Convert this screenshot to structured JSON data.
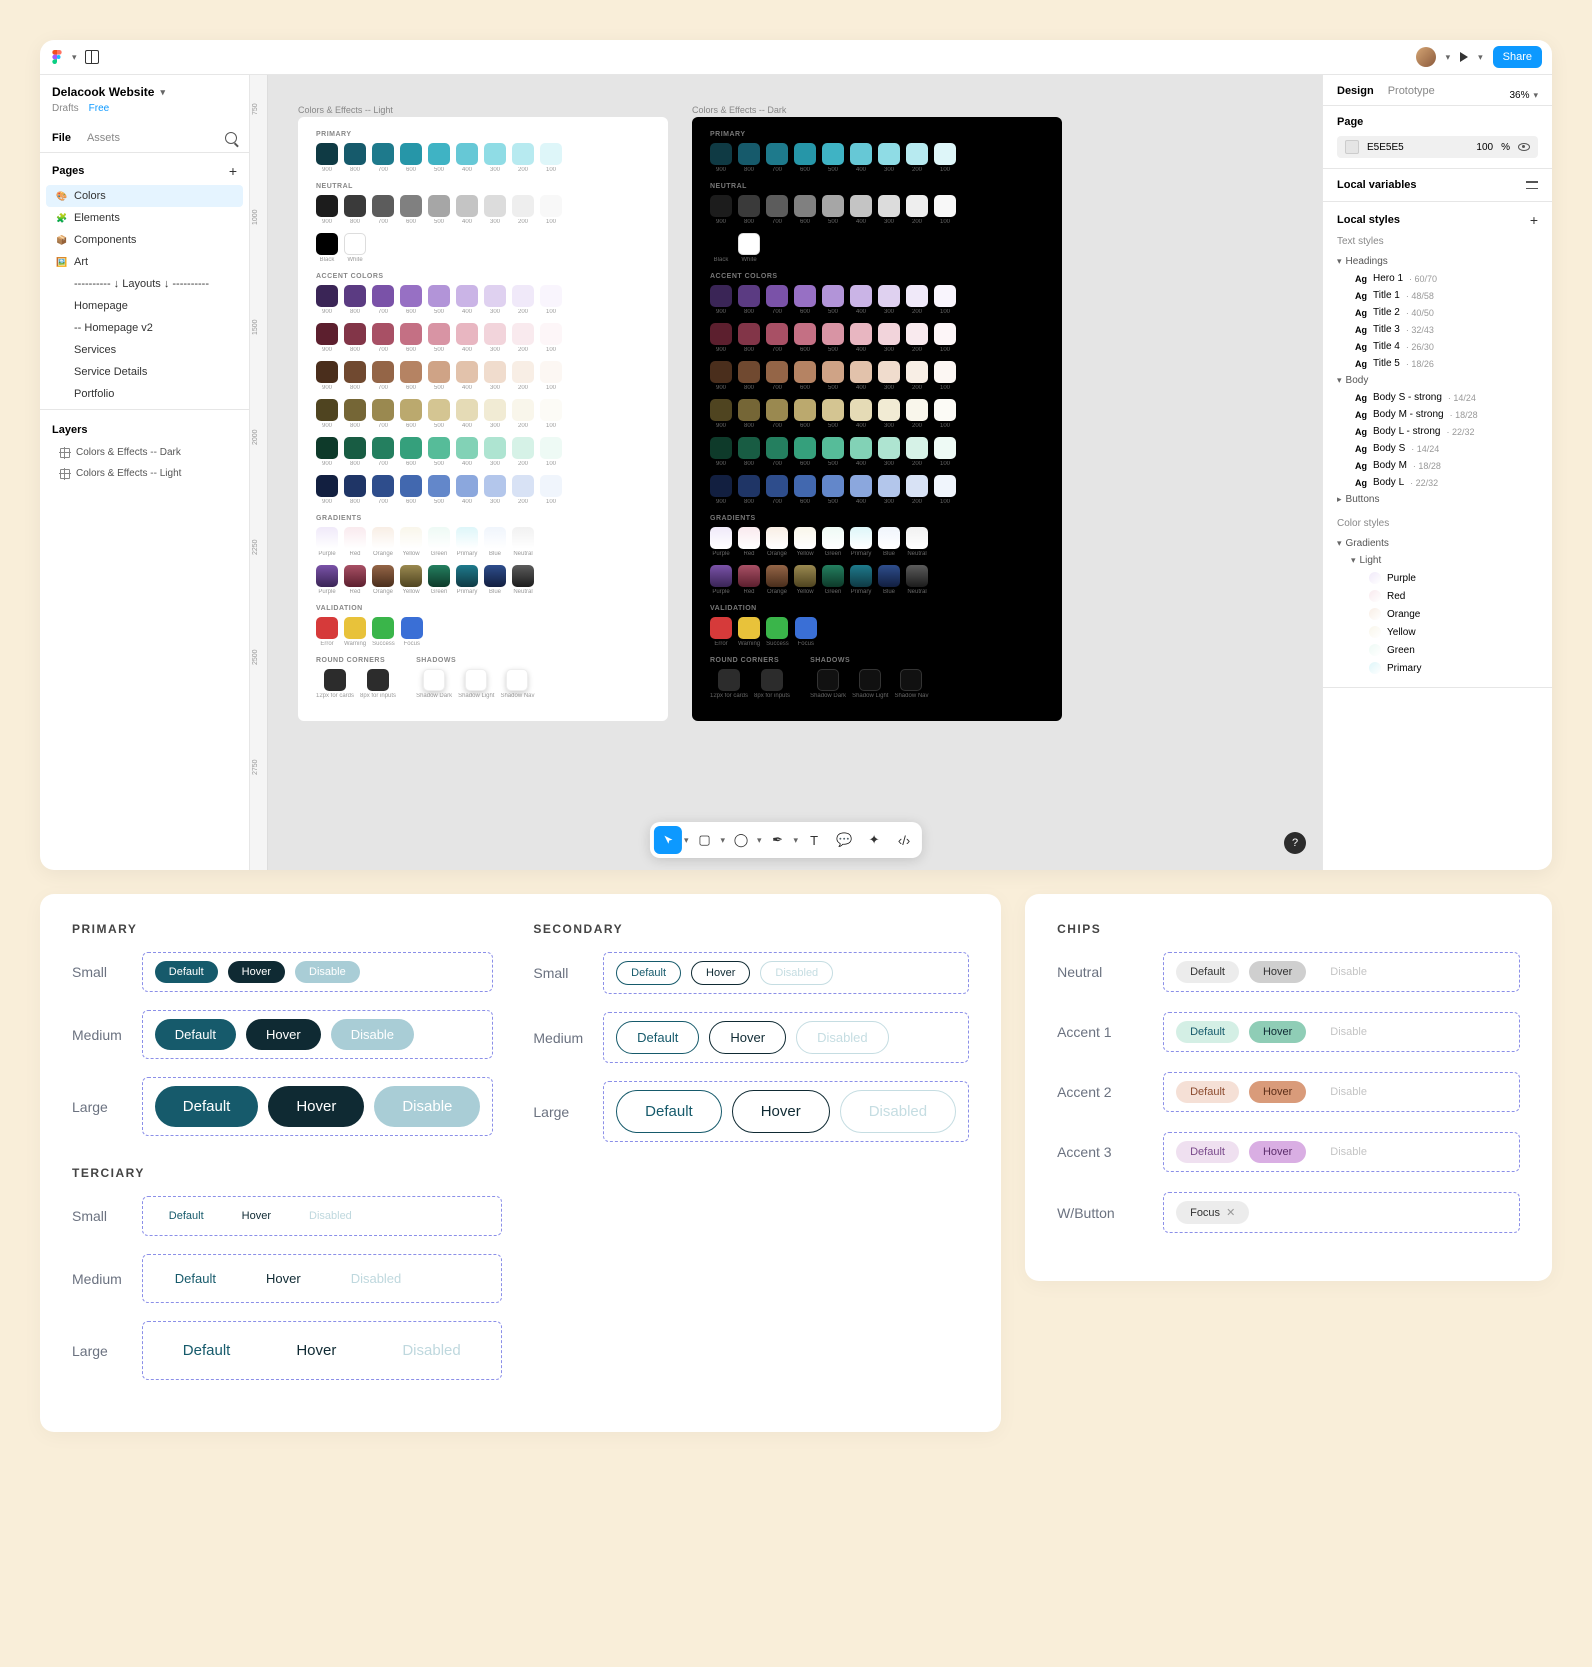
{
  "project": {
    "title": "Delacook Website",
    "drafts": "Drafts",
    "plan": "Free",
    "file_tab": "File",
    "assets_tab": "Assets"
  },
  "share": "Share",
  "pages": {
    "header": "Pages",
    "items": [
      {
        "icon": "🎨",
        "label": "Colors",
        "sel": true
      },
      {
        "icon": "🧩",
        "label": "Elements"
      },
      {
        "icon": "📦",
        "label": "Components"
      },
      {
        "icon": "🖼️",
        "label": "Art"
      },
      {
        "icon": "",
        "label": "---------- ↓ Layouts ↓ ----------"
      },
      {
        "icon": "",
        "label": "Homepage"
      },
      {
        "icon": "",
        "label": "-- Homepage v2"
      },
      {
        "icon": "",
        "label": "Services"
      },
      {
        "icon": "",
        "label": "Service Details"
      },
      {
        "icon": "",
        "label": "Portfolio"
      }
    ]
  },
  "layers": {
    "header": "Layers",
    "items": [
      "Colors & Effects -- Dark",
      "Colors & Effects -- Light"
    ]
  },
  "canvas_labels": {
    "light": "Colors & Effects -- Light",
    "dark": "Colors & Effects -- Dark"
  },
  "ruler": [
    "750",
    "1000",
    "1500",
    "2000",
    "2250",
    "2500",
    "2750"
  ],
  "palette": {
    "primary_title": "PRIMARY",
    "primary": [
      {
        "c": "#0F3A44",
        "l": "900"
      },
      {
        "c": "#165A6B",
        "l": "800"
      },
      {
        "c": "#1E7A8C",
        "l": "700"
      },
      {
        "c": "#2696A8",
        "l": "600"
      },
      {
        "c": "#3FB3C4",
        "l": "500"
      },
      {
        "c": "#66C8D6",
        "l": "400"
      },
      {
        "c": "#8FDCE5",
        "l": "300"
      },
      {
        "c": "#B7EAF0",
        "l": "200"
      },
      {
        "c": "#DEF6F9",
        "l": "100"
      }
    ],
    "neutral_title": "NEUTRAL",
    "neutral": [
      {
        "c": "#1C1C1C",
        "l": "900"
      },
      {
        "c": "#3A3A3A",
        "l": "800"
      },
      {
        "c": "#5C5C5C",
        "l": "700"
      },
      {
        "c": "#808080",
        "l": "600"
      },
      {
        "c": "#A6A6A6",
        "l": "500"
      },
      {
        "c": "#C4C4C4",
        "l": "400"
      },
      {
        "c": "#DCDCDC",
        "l": "300"
      },
      {
        "c": "#EEEEEE",
        "l": "200"
      },
      {
        "c": "#F8F8F8",
        "l": "100"
      }
    ],
    "bw": [
      {
        "c": "#000000",
        "l": "Black"
      },
      {
        "c": "#FFFFFF",
        "l": "White"
      }
    ],
    "accent_title": "ACCENT COLORS",
    "accent_rows": [
      [
        {
          "c": "#3A2556"
        },
        {
          "c": "#5B3B82"
        },
        {
          "c": "#7A52A8"
        },
        {
          "c": "#9770C4"
        },
        {
          "c": "#B294D8"
        },
        {
          "c": "#CAB4E6"
        },
        {
          "c": "#DFD1F0"
        },
        {
          "c": "#F0E9F9"
        },
        {
          "c": "#F9F5FD"
        }
      ],
      [
        {
          "c": "#5C1F2E"
        },
        {
          "c": "#823548"
        },
        {
          "c": "#A85065"
        },
        {
          "c": "#C47084"
        },
        {
          "c": "#D894A4"
        },
        {
          "c": "#E8B6C1"
        },
        {
          "c": "#F2D4DB"
        },
        {
          "c": "#F9EAEE"
        },
        {
          "c": "#FDF6F8"
        }
      ],
      [
        {
          "c": "#4A2E1C"
        },
        {
          "c": "#704930"
        },
        {
          "c": "#946547"
        },
        {
          "c": "#B58363"
        },
        {
          "c": "#CFA386"
        },
        {
          "c": "#E2C2AB"
        },
        {
          "c": "#F0DCCD"
        },
        {
          "c": "#F8EEE5"
        },
        {
          "c": "#FCF7F3"
        }
      ],
      [
        {
          "c": "#4F4420"
        },
        {
          "c": "#756636"
        },
        {
          "c": "#9A8950"
        },
        {
          "c": "#BBA96E"
        },
        {
          "c": "#D4C592"
        },
        {
          "c": "#E5DBB6"
        },
        {
          "c": "#F1EBD4"
        },
        {
          "c": "#F9F6EB"
        },
        {
          "c": "#FCFBF6"
        }
      ],
      [
        {
          "c": "#0E3A2A"
        },
        {
          "c": "#185C43"
        },
        {
          "c": "#247F5F"
        },
        {
          "c": "#35A07C"
        },
        {
          "c": "#56BC99"
        },
        {
          "c": "#82D2B6"
        },
        {
          "c": "#AEE4D1"
        },
        {
          "c": "#D6F2E7"
        },
        {
          "c": "#EEFAF5"
        }
      ],
      [
        {
          "c": "#121F40"
        },
        {
          "c": "#1F3566"
        },
        {
          "c": "#2E4D8C"
        },
        {
          "c": "#4268AF"
        },
        {
          "c": "#6387CA"
        },
        {
          "c": "#8BA7DD"
        },
        {
          "c": "#B3C6EB"
        },
        {
          "c": "#D8E2F5"
        },
        {
          "c": "#F0F5FC"
        }
      ]
    ],
    "row_labels": [
      "900",
      "800",
      "700",
      "600",
      "500",
      "400",
      "300",
      "200",
      "100"
    ],
    "gradients_title": "GRADIENTS",
    "grad_row1": [
      {
        "g": "linear-gradient(180deg,#F0E9F9,#fff)",
        "l": "Purple"
      },
      {
        "g": "linear-gradient(180deg,#F9EAEE,#fff)",
        "l": "Red"
      },
      {
        "g": "linear-gradient(180deg,#F8EEE5,#fff)",
        "l": "Orange"
      },
      {
        "g": "linear-gradient(180deg,#F9F6EB,#fff)",
        "l": "Yellow"
      },
      {
        "g": "linear-gradient(180deg,#EEFAF5,#fff)",
        "l": "Green"
      },
      {
        "g": "linear-gradient(180deg,#DEF6F9,#fff)",
        "l": "Primary"
      },
      {
        "g": "linear-gradient(180deg,#F0F5FC,#fff)",
        "l": "Blue"
      },
      {
        "g": "linear-gradient(180deg,#F1F1F1,#fff)",
        "l": "Neutral"
      }
    ],
    "grad_row2": [
      {
        "g": "linear-gradient(180deg,#7A52A8,#3A2556)",
        "l": "Purple"
      },
      {
        "g": "linear-gradient(180deg,#A85065,#5C1F2E)",
        "l": "Red"
      },
      {
        "g": "linear-gradient(180deg,#946547,#4A2E1C)",
        "l": "Orange"
      },
      {
        "g": "linear-gradient(180deg,#9A8950,#4F4420)",
        "l": "Yellow"
      },
      {
        "g": "linear-gradient(180deg,#247F5F,#0E3A2A)",
        "l": "Green"
      },
      {
        "g": "linear-gradient(180deg,#1E7A8C,#0F3A44)",
        "l": "Primary"
      },
      {
        "g": "linear-gradient(180deg,#2E4D8C,#121F40)",
        "l": "Blue"
      },
      {
        "g": "linear-gradient(180deg,#5C5C5C,#1C1C1C)",
        "l": "Neutral"
      }
    ],
    "validation_title": "VALIDATION",
    "validation": [
      {
        "c": "#D63A3A",
        "l": "Error"
      },
      {
        "c": "#E8C23A",
        "l": "Warning"
      },
      {
        "c": "#3AB54A",
        "l": "Success"
      },
      {
        "c": "#3A6FD6",
        "l": "Focus"
      }
    ],
    "round_title": "ROUND CORNERS",
    "shadow_title": "SHADOWS",
    "round_items": [
      {
        "c": "#2C2C2C",
        "l": "12px for cards"
      },
      {
        "c": "#2C2C2C",
        "l": "8px for inputs"
      }
    ],
    "shadow_items": [
      {
        "l": "Shadow Dark"
      },
      {
        "l": "Shadow Light"
      },
      {
        "l": "Shadow Nav"
      }
    ]
  },
  "rp": {
    "design": "Design",
    "prototype": "Prototype",
    "zoom": "36%",
    "page_title": "Page",
    "color_hex": "E5E5E5",
    "color_pct": "100",
    "pct_unit": "%",
    "local_vars": "Local variables",
    "local_styles": "Local styles",
    "text_styles": "Text styles",
    "headings": "Headings",
    "head_items": [
      {
        "n": "Hero 1",
        "m": "60/70"
      },
      {
        "n": "Title 1",
        "m": "48/58"
      },
      {
        "n": "Title 2",
        "m": "40/50"
      },
      {
        "n": "Title 3",
        "m": "32/43"
      },
      {
        "n": "Title 4",
        "m": "26/30"
      },
      {
        "n": "Title 5",
        "m": "18/26"
      }
    ],
    "body": "Body",
    "body_items": [
      {
        "n": "Body S - strong",
        "m": "14/24"
      },
      {
        "n": "Body M - strong",
        "m": "18/28"
      },
      {
        "n": "Body L - strong",
        "m": "22/32"
      },
      {
        "n": "Body S",
        "m": "14/24"
      },
      {
        "n": "Body M",
        "m": "18/28"
      },
      {
        "n": "Body L",
        "m": "22/32"
      }
    ],
    "buttons": "Buttons",
    "color_styles": "Color styles",
    "gradients": "Gradients",
    "light": "Light",
    "grad_items": [
      {
        "c": "linear-gradient(135deg,#F0E9F9,#fff)",
        "n": "Purple"
      },
      {
        "c": "linear-gradient(135deg,#F9EAEE,#fff)",
        "n": "Red"
      },
      {
        "c": "linear-gradient(135deg,#F8EEE5,#fff)",
        "n": "Orange"
      },
      {
        "c": "linear-gradient(135deg,#F9F6EB,#fff)",
        "n": "Yellow"
      },
      {
        "c": "linear-gradient(135deg,#EEFAF5,#fff)",
        "n": "Green"
      },
      {
        "c": "linear-gradient(135deg,#DEF6F9,#fff)",
        "n": "Primary"
      }
    ]
  },
  "btns": {
    "primary": "PRIMARY",
    "secondary": "SECONDARY",
    "terciary": "TERCIARY",
    "chips": "CHIPS",
    "small": "Small",
    "medium": "Medium",
    "large": "Large",
    "def": "Default",
    "hov": "Hover",
    "dis": "Disable",
    "disabled": "Disabled",
    "neutral": "Neutral",
    "a1": "Accent 1",
    "a2": "Accent 2",
    "a3": "Accent 3",
    "wbtn": "W/Button",
    "focus": "Focus"
  }
}
